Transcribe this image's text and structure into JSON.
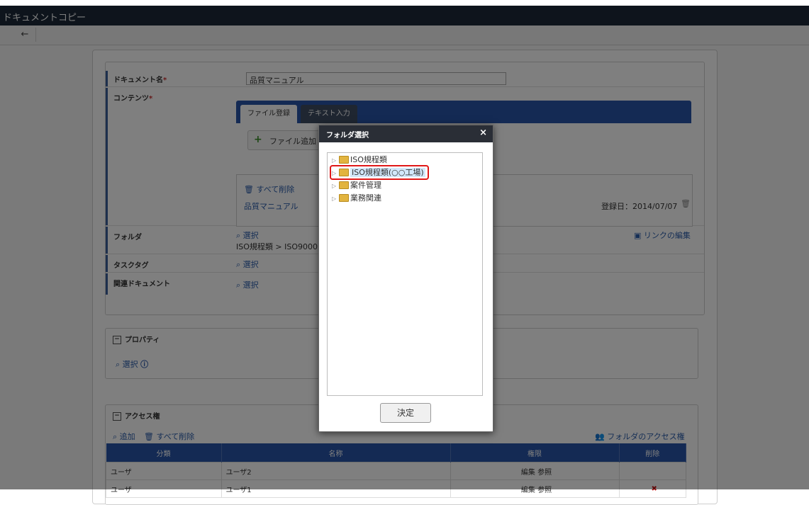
{
  "window": {
    "title": "ドキュメントコピー"
  },
  "toolbar": {
    "back_icon": "←"
  },
  "form": {
    "document_name_label": "ドキュメント名",
    "required_mark": "*",
    "document_name_value": "品質マニュアル",
    "content_label": "コンテンツ",
    "tabs": [
      "ファイル登録",
      "テキスト入力"
    ],
    "add_file_label": "ファイル追加",
    "delete_all_label": "すべて削除",
    "file_name": "品質マニュアル",
    "registered_date": "登録日：2014/07/07",
    "folder_label": "フォルダ",
    "folder_select": "選択",
    "folder_path": "ISO規程類 > ISO9000",
    "edit_link": "リンクの編集",
    "tasktag_label": "タスクタグ",
    "tasktag_select": "選択",
    "related_label": "関連ドキュメント",
    "related_select": "選択"
  },
  "properties": {
    "title": "プロパティ",
    "select": "選択"
  },
  "access": {
    "title": "アクセス権",
    "add": "追加",
    "delete_all": "すべて削除",
    "folder_access": "フォルダのアクセス権",
    "columns": [
      "分類",
      "名称",
      "権限",
      "削除"
    ],
    "rows": [
      {
        "type": "ユーザ",
        "name": "ユーザ2",
        "perm": "編集 参照"
      },
      {
        "type": "ユーザ",
        "name": "ユーザ1",
        "perm": "編集 参照"
      }
    ]
  },
  "modal": {
    "title": "フォルダ選択",
    "close_icon": "×",
    "tree": [
      "ISO規程類",
      "ISO規程類(○○工場)",
      "案件管理",
      "業務関連"
    ],
    "selected_index": 1,
    "decide_button": "決定"
  },
  "colors": {
    "header": "#1c2838",
    "accent": "#2855a8",
    "highlight": "#e01818"
  }
}
